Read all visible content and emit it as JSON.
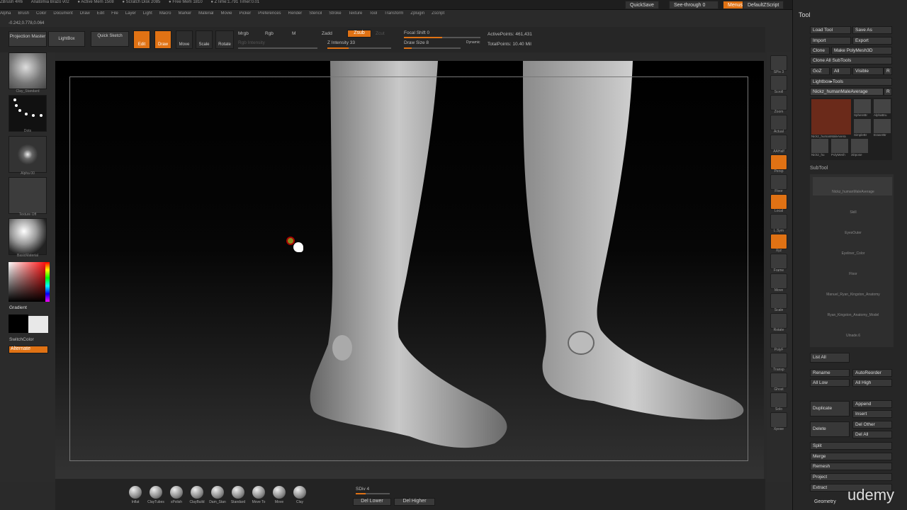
{
  "titlebar": {
    "app": "ZBrush 4R6",
    "doc": "Anatomia Brazo v02",
    "active_mem": "● Active Mem 1508",
    "scratch": "● Scratch Disk 2085",
    "free_mem": "● Free Mem 1810",
    "ztime": "● ZTime:1.791 Timer:0.01"
  },
  "menus": [
    "Alpha",
    "Brush",
    "Color",
    "Document",
    "Draw",
    "Edit",
    "File",
    "Layer",
    "Light",
    "Macro",
    "Marker",
    "Material",
    "Movie",
    "Picker",
    "Preferences",
    "Render",
    "Stencil",
    "Stroke",
    "Texture",
    "Tool",
    "Transform",
    "Zplugin",
    "Zscript"
  ],
  "top_right": {
    "quicksave": "QuickSave",
    "see_through": "See-through",
    "see_through_value": "0",
    "menus": "Menus",
    "default_zscript": "DefaultZScript"
  },
  "coords": "-0.242,0.778,0.064",
  "toolbar": {
    "projection_master": "Projection Master",
    "lightbox": "LightBox",
    "quick_sketch": "Quick Sketch",
    "edit": "Edit",
    "draw": "Draw",
    "move": "Move",
    "scale": "Scale",
    "rotate": "Rotate",
    "mrgb": "Mrgb",
    "rgb": "Rgb",
    "m": "M",
    "rgb_intensity": "Rgb Intensity",
    "zadd": "Zadd",
    "zsub": "Zsub",
    "zcut": "Zcut",
    "z_intensity": "Z Intensity 33",
    "focal_shift": "Focal Shift 0",
    "draw_size": "Draw Size 8",
    "dynamic": "Dynamic",
    "active_points": "ActivePoints: 461,431",
    "total_points": "TotalPoints: 10.40 Mil"
  },
  "left_shelf": {
    "brush_label": "Clay_Standard",
    "stroke_label": "Dots",
    "alpha_label": "Alpha 00",
    "texture_label": "Texture Off",
    "material_label": "BasicMaterial",
    "gradient": "Gradient",
    "switch_color": "SwitchColor",
    "alternate": "Alternate"
  },
  "right_shelf": [
    "SPix 3",
    "Scroll",
    "Zoom",
    "Actual",
    "AAHalf",
    "Persp",
    "Floor",
    "Local",
    "L.Sym",
    "Xyz",
    "Frame",
    "Move",
    "Scale",
    "Rotate",
    "PolyF",
    "Transp",
    "Ghost",
    "Solo",
    "Xpose"
  ],
  "tool_panel": {
    "title": "Tool",
    "load_tool": "Load Tool",
    "save_as": "Save As",
    "import": "Import",
    "export": "Export",
    "clone": "Clone",
    "make_polymesh": "Make PolyMesh3D",
    "clone_all": "Clone All SubTools",
    "goz": "GoZ",
    "all": "All",
    "visible": "Visible",
    "r": "R",
    "lightbox_tools": "Lightbox▸Tools",
    "current_tool": "Nickz_humanMaleAverage",
    "tool_r": "R",
    "thumbs": [
      "Nickz_humanMaleAvera",
      "SphereBr",
      "AlphaBru",
      "SimpleBr",
      "EraserBr",
      "Nickz_hu",
      "PolyMesh",
      "3Dpose"
    ],
    "subtool_title": "SubTool",
    "subtools": [
      "Nickz_humanMaleAverage",
      "Skill",
      "EyesOuter",
      "Eyeliner_Color",
      "Floor",
      "Manuel_Ryan_Kingston_Anatomy",
      "Ryan_Kingston_Anatomy_Model",
      "Ulnade.6"
    ],
    "list_all": "List All",
    "rename": "Rename",
    "autoreorder": "AutoReorder",
    "all_low": "All Low",
    "all_high": "All High",
    "duplicate": "Duplicate",
    "append": "Append",
    "insert": "Insert",
    "delete": "Delete",
    "del_other": "Del Other",
    "del_all": "Del All",
    "split": "Split",
    "merge": "Merge",
    "remesh": "Remesh",
    "project": "Project",
    "extract": "Extract",
    "geometry": "Geometry"
  },
  "bottom": {
    "brushes": [
      "Inflat",
      "ClayTubes",
      "sPolish",
      "ClayBuild",
      "Dam_Stan",
      "Standard",
      "Move To",
      "Move",
      "Clay"
    ],
    "sdiv": "SDiv 4",
    "del_lower": "Del Lower",
    "del_higher": "Del Higher"
  },
  "watermark": "udemy",
  "colors": {
    "accent": "#e07214",
    "panel": "#262626"
  }
}
